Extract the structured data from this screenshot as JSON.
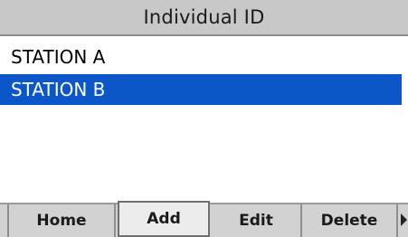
{
  "header": {
    "title": "Individual ID"
  },
  "list": {
    "items": [
      {
        "label": "STATION A",
        "selected": false
      },
      {
        "label": "STATION B",
        "selected": true
      }
    ]
  },
  "soft_keys": {
    "home": "Home",
    "add": "Add",
    "edit": "Edit",
    "delete": "Delete",
    "active": "add",
    "more_icon": "right-arrow-icon"
  },
  "colors": {
    "selection": "#0b57c7",
    "title_bar": "#c8c8c8",
    "soft_key_bar": "#d2d2d2"
  }
}
